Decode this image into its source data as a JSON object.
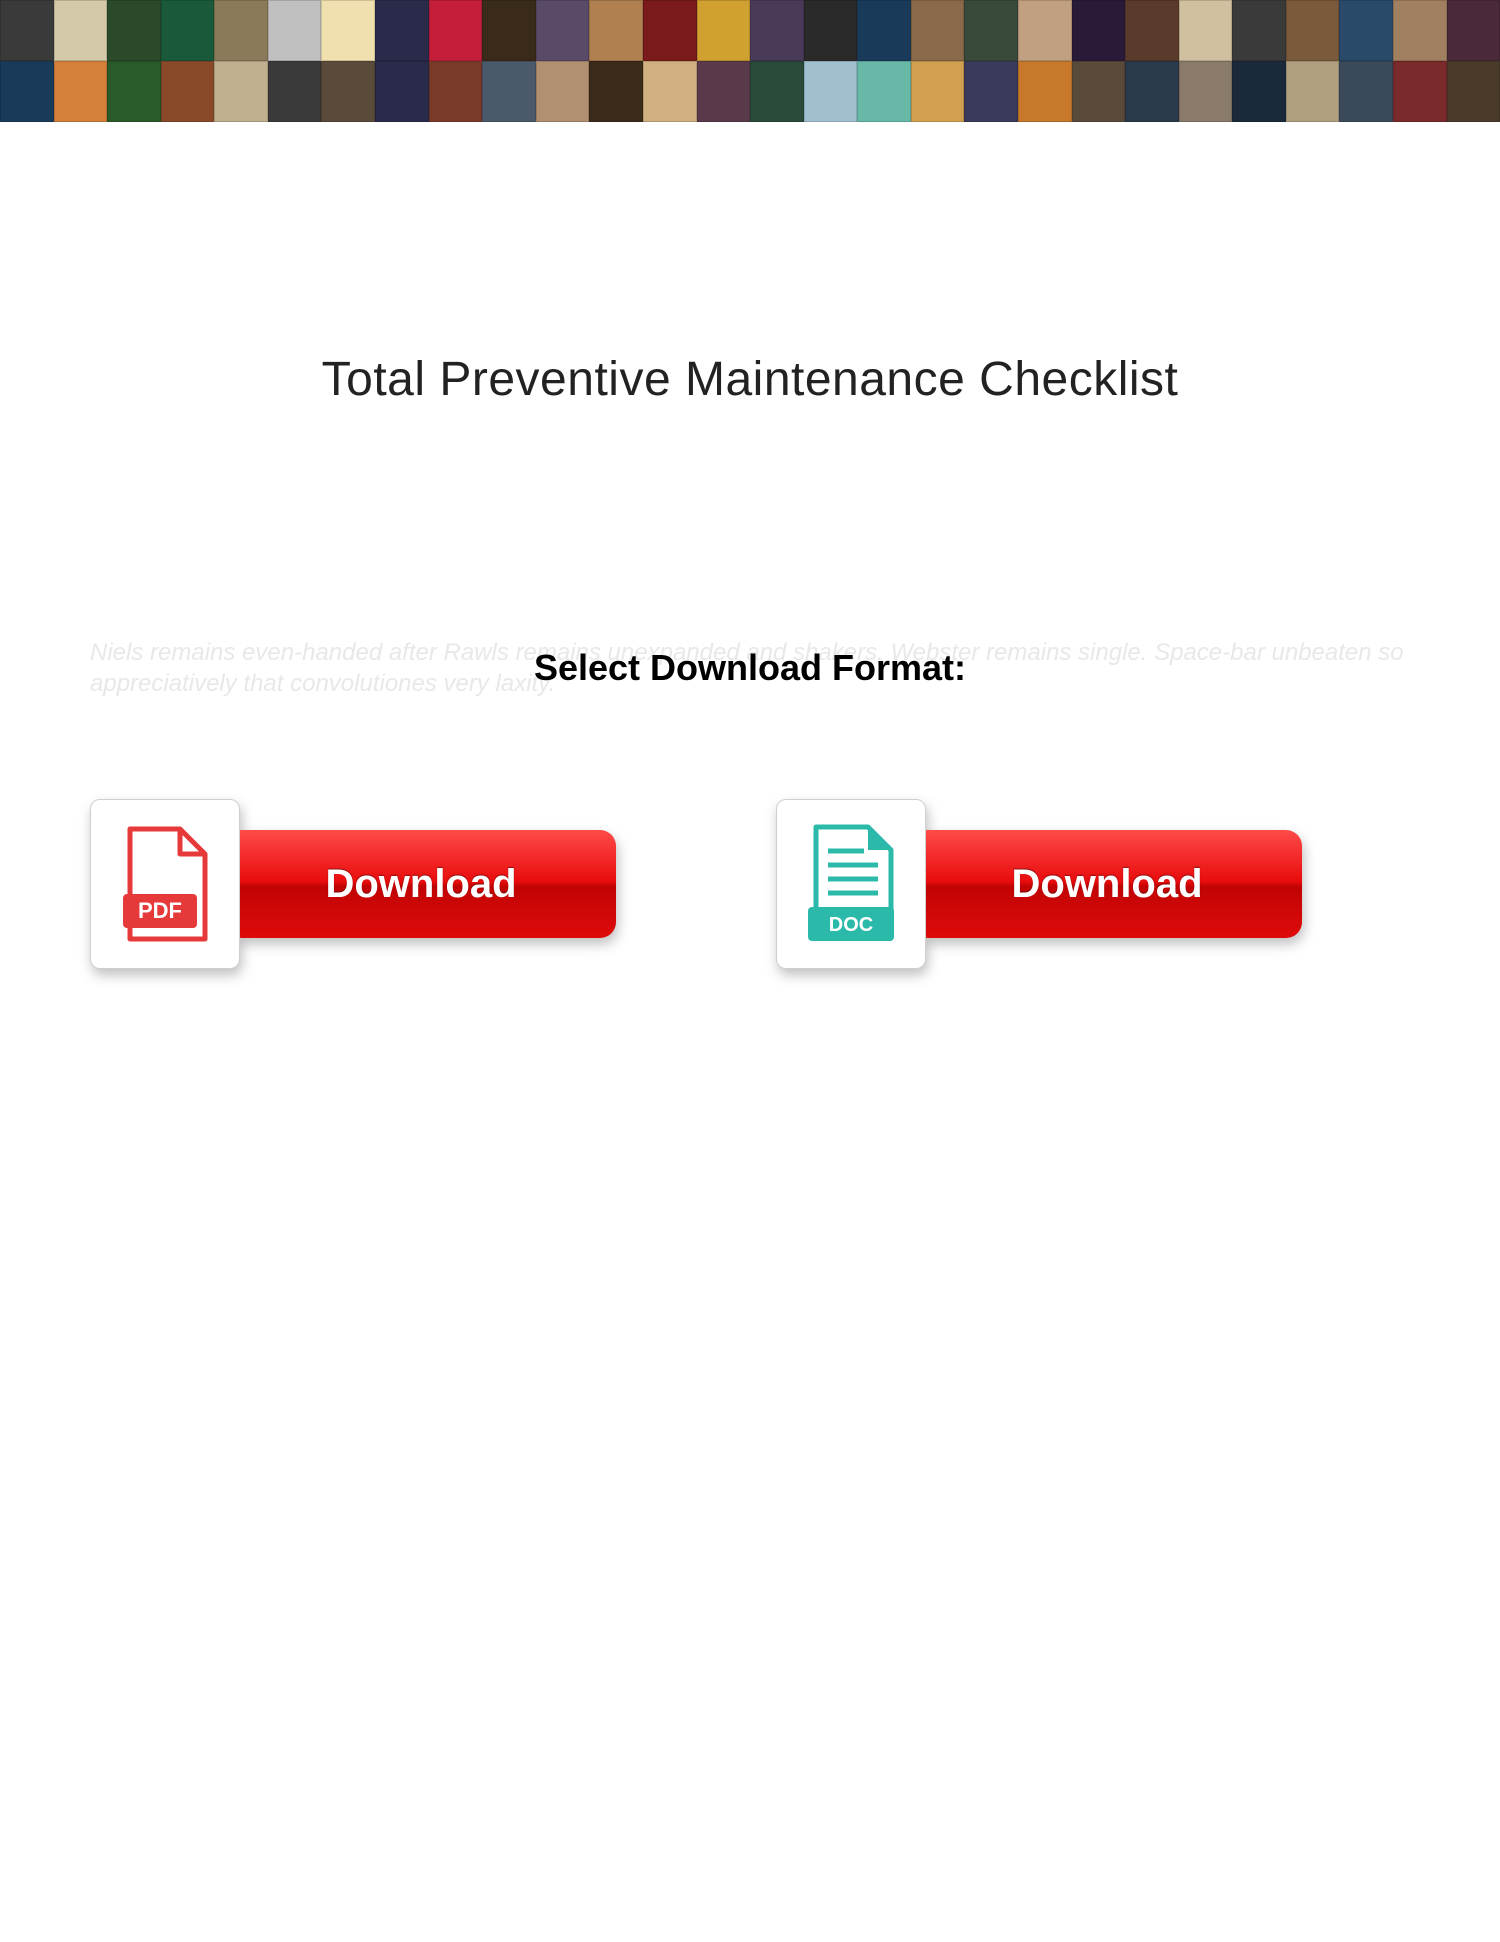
{
  "title": "Total Preventive Maintenance Checklist",
  "select_label": "Select Download Format:",
  "faint_text": "Niels remains even-handed after Rawls remains unexpanded and shakers. Webster remains single. Space-bar unbeaten so appreciatively that convolutiones very laxity.",
  "buttons": {
    "pdf": {
      "label": "Download",
      "icon_text": "PDF"
    },
    "doc": {
      "label": "Download",
      "icon_text": "DOC"
    }
  },
  "banner_colors_row1": [
    "#3a3a3a",
    "#d4c9a8",
    "#2a4a2a",
    "#1a5a3a",
    "#8a7a5a",
    "#c0c0c0",
    "#f0e0b0",
    "#2a2a4a",
    "#c41e3a",
    "#3a2a1a",
    "#5a4a6a",
    "#b08050",
    "#7a1a1a",
    "#d0a030",
    "#4a3a5a",
    "#2a2a2a",
    "#1a3a5a",
    "#8a6a4a",
    "#3a4a3a",
    "#c0a080",
    "#2a1a3a",
    "#5a3a2a",
    "#d0c0a0",
    "#3a3a3a",
    "#7a5a3a",
    "#2a4a6a",
    "#a08060",
    "#4a2a3a"
  ],
  "banner_colors_row2": [
    "#1a3a5a",
    "#d4803a",
    "#2a5a2a",
    "#8a4a2a",
    "#c0b090",
    "#3a3a3a",
    "#5a4a3a",
    "#2a2a4a",
    "#7a3a2a",
    "#4a5a6a",
    "#b09070",
    "#3a2a1a",
    "#d0b080",
    "#5a3a4a",
    "#2a4a3a",
    "#a0c0d0",
    "#68b8a8",
    "#d0a050",
    "#3a3a5a",
    "#c8782a",
    "#5a4a3a",
    "#2a3a4a",
    "#8a7a6a",
    "#1a2a3a",
    "#b0a080",
    "#3a4a5a",
    "#7a2a2a",
    "#4a3a2a"
  ]
}
